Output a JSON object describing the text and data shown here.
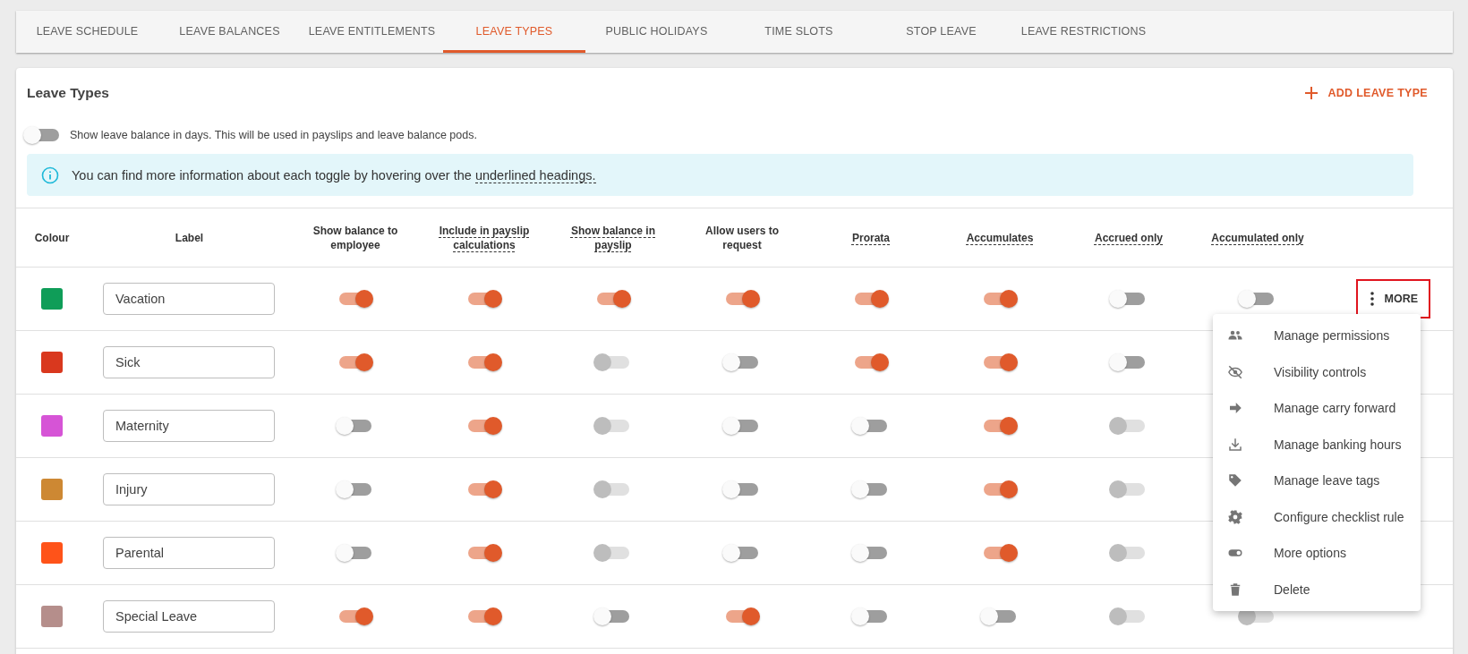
{
  "tabs": [
    {
      "label": "LEAVE SCHEDULE",
      "selected": false
    },
    {
      "label": "LEAVE BALANCES",
      "selected": false
    },
    {
      "label": "LEAVE ENTITLEMENTS",
      "selected": false
    },
    {
      "label": "LEAVE TYPES",
      "selected": true
    },
    {
      "label": "PUBLIC HOLIDAYS",
      "selected": false
    },
    {
      "label": "TIME SLOTS",
      "selected": false
    },
    {
      "label": "STOP LEAVE",
      "selected": false
    },
    {
      "label": "LEAVE RESTRICTIONS",
      "selected": false
    }
  ],
  "card": {
    "title": "Leave Types",
    "add_button": "ADD LEAVE TYPE",
    "days_toggle": {
      "on": false,
      "label": "Show leave balance in days. This will be used in payslips and leave balance pods."
    },
    "info": {
      "text": "You can find more information about each toggle by hovering over the ",
      "link": "underlined headings."
    }
  },
  "table": {
    "columns": [
      {
        "text": "Colour",
        "underlined": false
      },
      {
        "text": "Label",
        "underlined": false
      },
      {
        "text": "Show balance to employee",
        "underlined": false
      },
      {
        "text": "Include in payslip calculations",
        "underlined": true
      },
      {
        "text": "Show balance in payslip",
        "underlined": true
      },
      {
        "text": "Allow users to request",
        "underlined": false
      },
      {
        "text": "Prorata",
        "underlined": true
      },
      {
        "text": "Accumulates",
        "underlined": true
      },
      {
        "text": "Accrued only",
        "underlined": true
      },
      {
        "text": "Accumulated only",
        "underlined": true
      }
    ],
    "rows": [
      {
        "color": "#0f9d58",
        "label": "Vacation",
        "toggles": [
          {
            "on": true,
            "disabled": false
          },
          {
            "on": true,
            "disabled": false
          },
          {
            "on": true,
            "disabled": false
          },
          {
            "on": true,
            "disabled": false
          },
          {
            "on": true,
            "disabled": false
          },
          {
            "on": true,
            "disabled": false
          },
          {
            "on": false,
            "disabled": false
          },
          {
            "on": false,
            "disabled": false
          }
        ],
        "more": {
          "label": "MORE",
          "highlighted": true
        }
      },
      {
        "color": "#d9381e",
        "label": "Sick",
        "toggles": [
          {
            "on": true,
            "disabled": false
          },
          {
            "on": true,
            "disabled": false
          },
          {
            "on": false,
            "disabled": true
          },
          {
            "on": false,
            "disabled": false
          },
          {
            "on": true,
            "disabled": false
          },
          {
            "on": true,
            "disabled": false
          },
          {
            "on": false,
            "disabled": false
          }
        ]
      },
      {
        "color": "#d654d6",
        "label": "Maternity",
        "toggles": [
          {
            "on": false,
            "disabled": false
          },
          {
            "on": true,
            "disabled": false
          },
          {
            "on": false,
            "disabled": true
          },
          {
            "on": false,
            "disabled": false
          },
          {
            "on": false,
            "disabled": false
          },
          {
            "on": true,
            "disabled": false
          },
          {
            "on": false,
            "disabled": true
          }
        ]
      },
      {
        "color": "#cd8833",
        "label": "Injury",
        "toggles": [
          {
            "on": false,
            "disabled": false
          },
          {
            "on": true,
            "disabled": false
          },
          {
            "on": false,
            "disabled": true
          },
          {
            "on": false,
            "disabled": false
          },
          {
            "on": false,
            "disabled": false
          },
          {
            "on": true,
            "disabled": false
          },
          {
            "on": false,
            "disabled": true
          }
        ]
      },
      {
        "color": "#ff5319",
        "label": "Parental",
        "toggles": [
          {
            "on": false,
            "disabled": false
          },
          {
            "on": true,
            "disabled": false
          },
          {
            "on": false,
            "disabled": true
          },
          {
            "on": false,
            "disabled": false
          },
          {
            "on": false,
            "disabled": false
          },
          {
            "on": true,
            "disabled": false
          },
          {
            "on": false,
            "disabled": true
          }
        ]
      },
      {
        "color": "#b58e8b",
        "label": "Special Leave",
        "toggles": [
          {
            "on": true,
            "disabled": false
          },
          {
            "on": true,
            "disabled": false
          },
          {
            "on": false,
            "disabled": false
          },
          {
            "on": true,
            "disabled": false
          },
          {
            "on": false,
            "disabled": false
          },
          {
            "on": false,
            "disabled": false
          },
          {
            "on": false,
            "disabled": true
          },
          {
            "on": false,
            "disabled": true
          }
        ]
      }
    ]
  },
  "more_menu": {
    "items": [
      "Manage permissions",
      "Visibility controls",
      "Manage carry forward",
      "Manage banking hours",
      "Manage leave tags",
      "Configure checklist rule",
      "More options",
      "Delete"
    ]
  }
}
